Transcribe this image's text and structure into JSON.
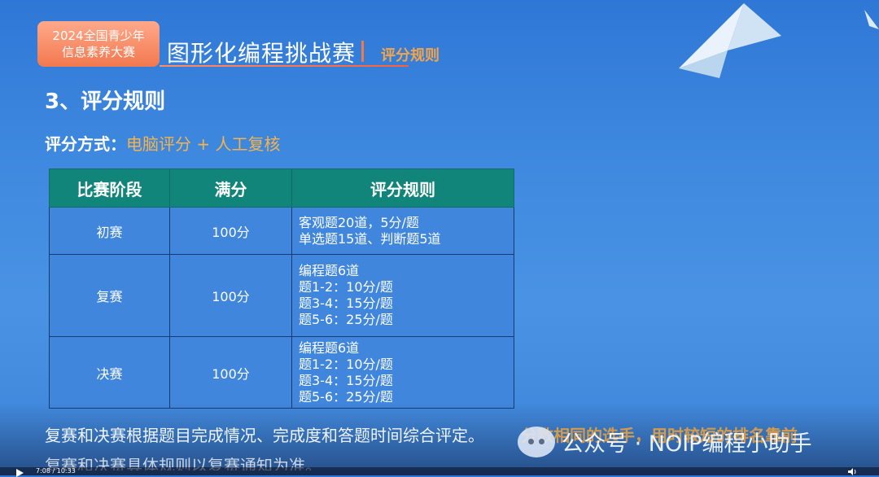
{
  "header": {
    "badge_line1": "2024全国青少年",
    "badge_line2": "信息素养大赛",
    "title": "图形化编程挑战赛",
    "subtitle": "评分规则"
  },
  "section_title": "3、评分规则",
  "method": {
    "label": "评分方式：",
    "value": "电脑评分 + 人工复核"
  },
  "table": {
    "headers": [
      "比赛阶段",
      "满分",
      "评分规则"
    ],
    "rows": [
      {
        "stage": "初赛",
        "score": "100分",
        "rules": [
          "客观题20道，5分/题",
          "单选题15道、判断题5道"
        ]
      },
      {
        "stage": "复赛",
        "score": "100分",
        "rules": [
          "编程题6道",
          "题1-2：10分/题",
          "题3-4：15分/题",
          "题5-6：25分/题"
        ]
      },
      {
        "stage": "决赛",
        "score": "100分",
        "rules": [
          "编程题6道",
          "题1-2：10分/题",
          "题3-4：15分/题",
          "题5-6：25分/题"
        ]
      }
    ]
  },
  "notes": {
    "line1": "复赛和决赛根据题目完成情况、完成度和答题时间综合评定。",
    "line2": "复赛和决赛具体规则以复赛通知为准。"
  },
  "overlay_text": "分数相同的选手，用时较短的排名靠前",
  "watermark": "公众号 · NOIP编程小助手",
  "player": {
    "time": "7:08 / 10:33"
  },
  "colors": {
    "background": "#3f8ae0",
    "table_header": "#12857a",
    "accent_orange": "#f7b24a",
    "badge": "#f2784f"
  }
}
